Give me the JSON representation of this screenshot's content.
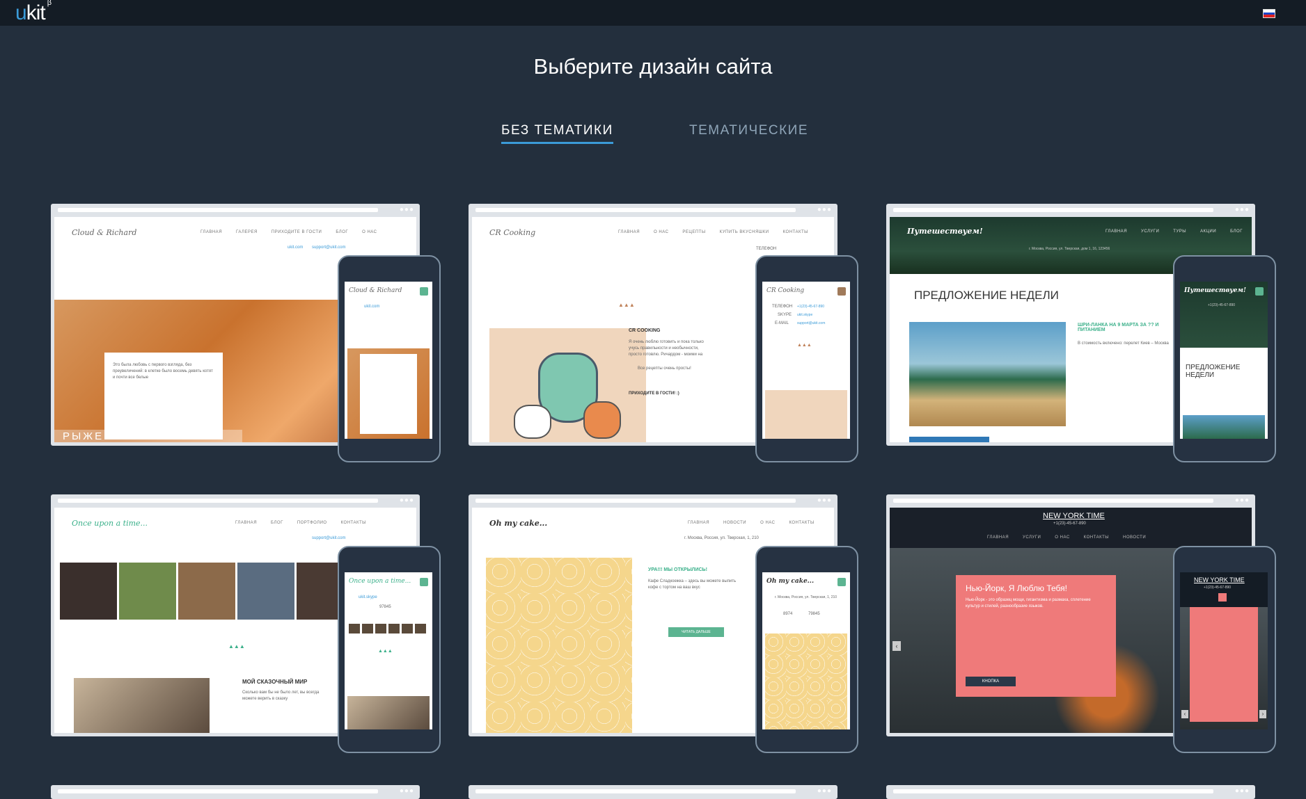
{
  "app": {
    "logo_main": "ukit",
    "logo_super": "β",
    "language_flag": "ru-flag"
  },
  "header": {
    "title": "Выберите дизайн сайта"
  },
  "tabs": [
    {
      "label": "БЕЗ ТЕМАТИКИ",
      "active": true
    },
    {
      "label": "ТЕМАТИЧЕСКИЕ",
      "active": false
    }
  ],
  "colors": {
    "page_bg": "#232f3d",
    "topbar_bg": "#141c25",
    "accent": "#3b9bd8",
    "teal": "#5cb491"
  },
  "templates": [
    {
      "logo": "Cloud & Richard",
      "nav": [
        "ГЛАВНАЯ",
        "ГАЛЕРЕЯ",
        "ПРИХОДИТЕ В ГОСТИ",
        "БЛОГ",
        "О НАС"
      ],
      "contact1": "ukit.com",
      "contact2": "support@ukit.com",
      "banner": "РЫЖЕЕ СЧАСТЬЕ",
      "body": "Это была любовь с первого взгляда, без преувеличений: в клетке было восемь девять котят и почти все белые"
    },
    {
      "logo": "CR Cooking",
      "nav": [
        "ГЛАВНАЯ",
        "О НАС",
        "РЕЦЕПТЫ",
        "КУПИТЬ ВКУСНЯШКИ",
        "КОНТАКТЫ"
      ],
      "phone_label": "ТЕЛЕФОН",
      "phone": "+1(23)-45-67-890",
      "skype_label": "SKYPE",
      "skype": "ukit.skype",
      "email_label": "E-MAIL",
      "email": "support@ukit.com",
      "heading": "CR COOKING",
      "body": "Я очень люблю готовить и пока только учусь правильности и необычности, просто готовлю. Ричардом - моими на",
      "line2": "Все рецепты очень просты!",
      "line3": "ПРИХОДИТЕ В ГОСТИ! :)"
    },
    {
      "logo": "Путешествуем!",
      "nav": [
        "ГЛАВНАЯ",
        "УСЛУГИ",
        "ТУРЫ",
        "АКЦИИ",
        "БЛОГ"
      ],
      "phone": "+1(23)-45-67-890",
      "address": "г. Москва, Россия, ул. Тверская, дом 1, 16, 123456",
      "heading": "ПРЕДЛОЖЕНИЕ НЕДЕЛИ",
      "offer": "ШРИ-ЛАНКА НА 9 МАРТА ЗА ?? И ПИТАНИЕМ",
      "body": "В стоимость включено: перелет Киев – Москва"
    },
    {
      "logo": "Once upon a time...",
      "nav": [
        "ГЛАВНАЯ",
        "БЛОГ",
        "ПОРТФОЛИО",
        "КОНТАКТЫ"
      ],
      "contact1": "ukit.skype",
      "contact2": "support@ukit.com",
      "contact3": "97845",
      "heading": "МОЙ СКАЗОЧНЫЙ МИР",
      "body": "Сколько вам бы не было лет, вы всегда можете верить в сказку"
    },
    {
      "logo": "Oh my cake...",
      "nav": [
        "ГЛАВНАЯ",
        "НОВОСТИ",
        "О НАС",
        "КОНТАКТЫ"
      ],
      "address": "г. Москва, Россия, ул. Тверская, 1, 210",
      "phone1": "8974",
      "phone2": "79845",
      "heading": "УРА!!! МЫ ОТКРЫЛИСЬ!",
      "body": "Кафе Сладкоежка – здесь вы можете выпить кофе с тортом на ваш вкус",
      "button": "ЧИТАТЬ ДАЛЬШЕ"
    },
    {
      "logo": "NEW YORK TIME",
      "phone": "+1(23)-45-67-890",
      "nav": [
        "ГЛАВНАЯ",
        "УСЛУГИ",
        "О НАС",
        "КОНТАКТЫ",
        "НОВОСТИ"
      ],
      "heading": "Нью-Йорк, Я Люблю Тебя!",
      "body": "Нью-Йорк - это образец мощи, гигантизма и размаха, сплетение культур и стилей, разнообразие языков.",
      "button": "КНОПКА"
    }
  ]
}
